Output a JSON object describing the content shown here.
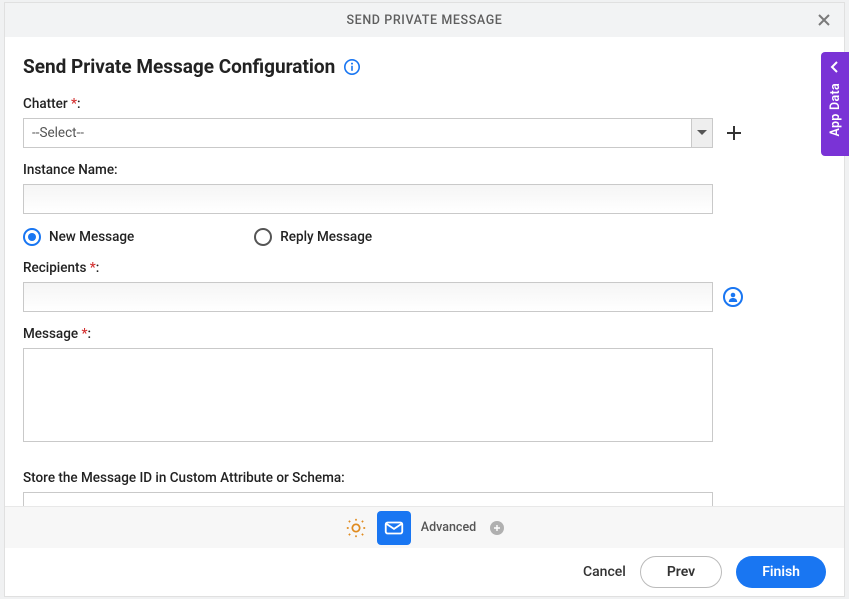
{
  "titlebar": {
    "title": "SEND PRIVATE MESSAGE"
  },
  "page": {
    "heading": "Send Private Message Configuration"
  },
  "fields": {
    "chatter": {
      "label": "Chatter ",
      "req": "*",
      "colon": ":",
      "selected": "--Select--"
    },
    "instance": {
      "label": "Instance Name:"
    },
    "radios": {
      "new": "New Message",
      "reply": "Reply Message"
    },
    "recipients": {
      "label": "Recipients ",
      "req": "*",
      "colon": ":"
    },
    "message": {
      "label": "Message ",
      "req": "*",
      "colon": ":"
    },
    "store": {
      "label": "Store the Message ID in Custom Attribute or Schema:"
    }
  },
  "toolbar": {
    "advanced": "Advanced"
  },
  "footer": {
    "cancel": "Cancel",
    "prev": "Prev",
    "finish": "Finish"
  },
  "side": {
    "label": "App Data"
  }
}
